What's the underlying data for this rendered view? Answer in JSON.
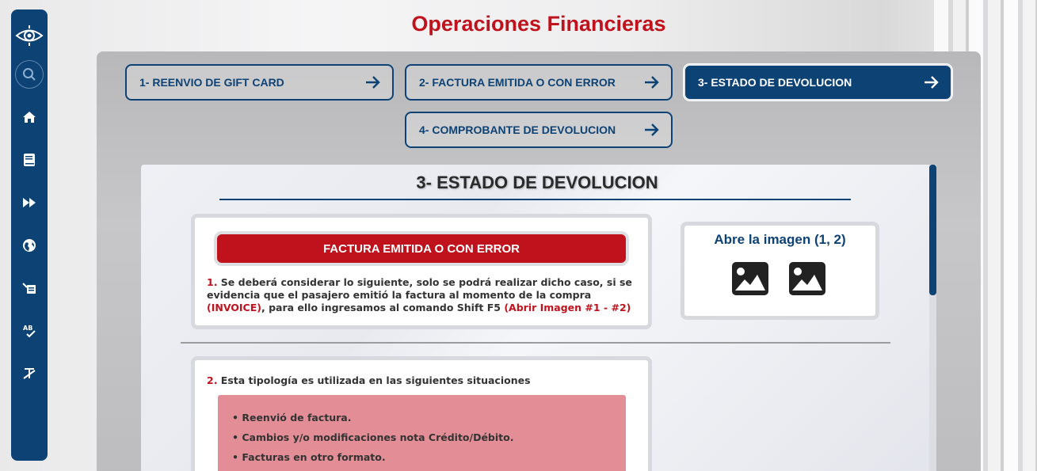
{
  "page": {
    "title": "Operaciones Financieras",
    "colors": {
      "brand_blue": "#0d4275",
      "brand_red": "#c0121d",
      "pink": "#e38e96"
    }
  },
  "sidebar": {
    "items": [
      {
        "name": "logo",
        "icon": "eye-logo-icon"
      },
      {
        "name": "search",
        "icon": "search-icon"
      },
      {
        "name": "home",
        "icon": "home-icon"
      },
      {
        "name": "book",
        "icon": "book-icon"
      },
      {
        "name": "fast-forward",
        "icon": "fast-forward-icon"
      },
      {
        "name": "globe",
        "icon": "globe-icon"
      },
      {
        "name": "reader",
        "icon": "reader-icon"
      },
      {
        "name": "spellcheck",
        "icon": "spellcheck-icon"
      },
      {
        "name": "clear-format",
        "icon": "clear-format-icon"
      }
    ]
  },
  "nav": {
    "buttons": [
      {
        "label": "1- REENVIO DE GIFT CARD",
        "active": false
      },
      {
        "label": "2- FACTURA EMITIDA O CON ERROR",
        "active": false
      },
      {
        "label": "3- ESTADO DE DEVOLUCION",
        "active": true
      },
      {
        "label": "4- COMPROBANTE DE DEVOLUCION",
        "active": false
      }
    ]
  },
  "content": {
    "title": "3- ESTADO DE DEVOLUCION",
    "banner": "FACTURA EMITIDA O CON ERROR",
    "step1": {
      "num": "1.",
      "text_a": " Se deberá considerar lo siguiente, solo se podrá realizar dicho caso, si se evidencia que el pasajero emitió la factura al momento de la compra ",
      "invoice": "(INVOICE)",
      "text_b": ", para ello ingresamos al comando Shift F5 ",
      "open": "(Abrir Imagen #1 - #2)"
    },
    "images": {
      "title": "Abre la imagen (1, 2)"
    },
    "step2": {
      "num": "2.",
      "text": " Esta tipología es utilizada en las siguientes situaciones",
      "items": [
        "• Reenvió de factura.",
        "• Cambios y/o modificaciones nota Crédito/Débito.",
        "• Facturas en otro formato."
      ]
    }
  }
}
